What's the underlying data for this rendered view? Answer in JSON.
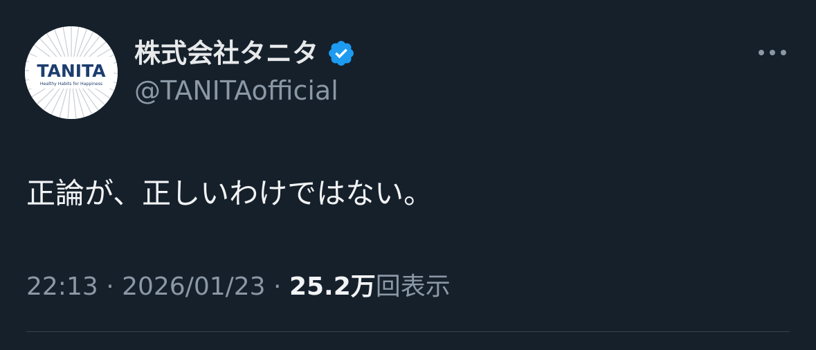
{
  "author": {
    "display_name": "株式会社タニタ",
    "handle": "@TANITAofficial",
    "verified": true,
    "avatar": {
      "logo_text": "TANITA",
      "tagline": "Healthy Habits for Happiness"
    }
  },
  "tweet": {
    "text": "正論が、正しいわけではない。"
  },
  "meta": {
    "time": "22:13",
    "separator1": " · ",
    "date": "2026/01/23",
    "separator2": " · ",
    "views_count": "25.2万",
    "views_label": "回表示"
  },
  "icons": {
    "verified": "verified-badge-icon",
    "more": "more-horizontal-icon"
  },
  "colors": {
    "background": "#15202b",
    "verified_blue": "#1d9bf0",
    "secondary_text": "#8b98a5",
    "primary_text": "#e7e9ea",
    "tanita_navy": "#1d3d6e"
  }
}
